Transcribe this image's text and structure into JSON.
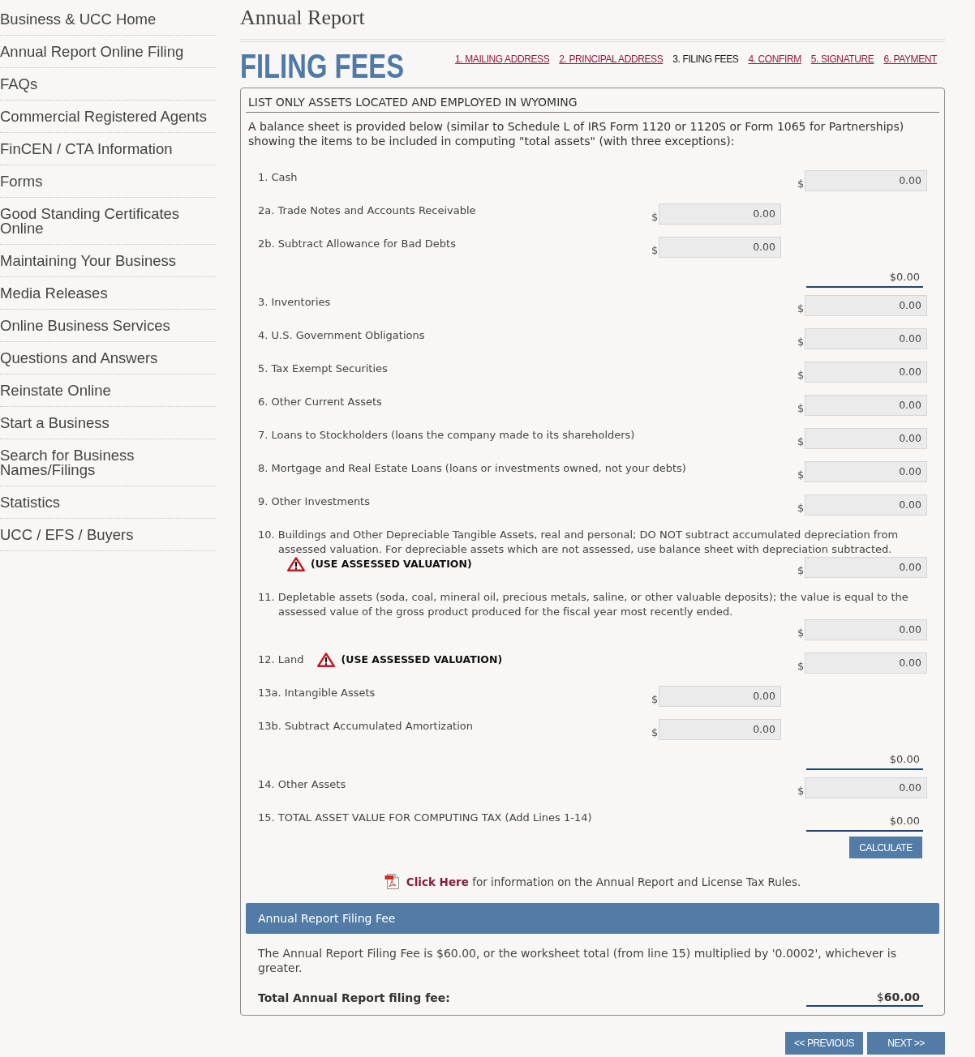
{
  "sidebar": {
    "items": [
      "Business & UCC Home",
      "Annual Report Online Filing",
      "FAQs",
      "Commercial Registered Agents",
      "FinCEN / CTA Information",
      "Forms",
      "Good Standing Certificates Online",
      "Maintaining Your Business",
      "Media Releases",
      "Online Business Services",
      "Questions and Answers",
      "Reinstate Online",
      "Start a Business",
      "Search for Business Names/Filings",
      "Statistics",
      "UCC / EFS / Buyers"
    ]
  },
  "page_title": "Annual Report",
  "heading": "FILING FEES",
  "steps": [
    {
      "label": "1. MAILING ADDRESS",
      "selected": false
    },
    {
      "label": "2. PRINCIPAL ADDRESS",
      "selected": false
    },
    {
      "label": "3. FILING FEES",
      "selected": true
    },
    {
      "label": "4. CONFIRM",
      "selected": false
    },
    {
      "label": "5. SIGNATURE",
      "selected": false
    },
    {
      "label": "6. PAYMENT",
      "selected": false
    }
  ],
  "worksheet": {
    "title": "LIST ONLY ASSETS LOCATED AND EMPLOYED IN WYOMING",
    "intro": "A balance sheet is provided below (similar to Schedule L of IRS Form 1120 or 1120S or Form 1065 for Partnerships) showing the items to be included in computing \"total assets\" (with three exceptions):",
    "lines": [
      {
        "kind": "field",
        "label": "1. Cash",
        "currency": "$",
        "value": "0.00"
      },
      {
        "kind": "subfield",
        "label": "2a. Trade Notes and Accounts Receivable",
        "currency": "$",
        "value": "0.00"
      },
      {
        "kind": "subfield",
        "label": "2b. Subtract Allowance for Bad Debts",
        "currency": "$",
        "value": "0.00"
      },
      {
        "kind": "subtotal",
        "value": "$0.00"
      },
      {
        "kind": "field",
        "label": "3. Inventories",
        "currency": "$",
        "value": "0.00"
      },
      {
        "kind": "field",
        "label": "4. U.S. Government Obligations",
        "currency": "$",
        "value": "0.00"
      },
      {
        "kind": "field",
        "label": "5. Tax Exempt Securities",
        "currency": "$",
        "value": "0.00"
      },
      {
        "kind": "field",
        "label": "6. Other Current Assets",
        "currency": "$",
        "value": "0.00"
      },
      {
        "kind": "field",
        "label": "7. Loans to Stockholders (loans the company made to its shareholders)",
        "currency": "$",
        "value": "0.00"
      },
      {
        "kind": "field",
        "label": "8. Mortgage and Real Estate Loans (loans or investments owned, not your debts)",
        "currency": "$",
        "value": "0.00"
      },
      {
        "kind": "field",
        "label": "9. Other Investments",
        "currency": "$",
        "value": "0.00"
      },
      {
        "kind": "field",
        "label": "10. Buildings and Other Depreciable Tangible Assets, real and personal; DO NOT subtract accumulated depreciation from assessed valuation.  For depreciable assets which are not assessed, use balance sheet with depreciation subtracted.",
        "warning": {
          "text": "(USE ASSESSED VALUATION)",
          "inline": false
        },
        "currency": "$",
        "value": "0.00"
      },
      {
        "kind": "field",
        "label": "11. Depletable assets (soda, coal, mineral oil, precious metals, saline, or other valuable deposits); the value is equal to the assessed value of the gross product produced for the fiscal year most recently ended.",
        "currency": "$",
        "value": "0.00"
      },
      {
        "kind": "field",
        "label": "12. Land",
        "warning": {
          "text": "(USE ASSESSED VALUATION)",
          "inline": true
        },
        "currency": "$",
        "value": "0.00"
      },
      {
        "kind": "subfield",
        "label": "13a. Intangible Assets",
        "currency": "$",
        "value": "0.00"
      },
      {
        "kind": "subfield",
        "label": "13b. Subtract Accumulated Amortization",
        "currency": "$",
        "value": "0.00"
      },
      {
        "kind": "subtotal",
        "value": "$0.00"
      },
      {
        "kind": "field",
        "label": "14. Other Assets",
        "currency": "$",
        "value": "0.00"
      },
      {
        "kind": "total",
        "label": "15. TOTAL ASSET VALUE FOR COMPUTING TAX (Add Lines 1-14)",
        "value": "$0.00"
      }
    ],
    "calculate_button": "CALCULATE",
    "info": {
      "link": "Click Here",
      "text": " for information on the Annual Report and License Tax Rules."
    }
  },
  "fee": {
    "title": "Annual Report Filing Fee",
    "description": "The Annual Report Filing Fee is $60.00, or the worksheet total (from line 15) multiplied by '0.0002', whichever is greater.",
    "total_label": "Total Annual Report filing fee:",
    "total_value": "$**60.00**"
  },
  "nav_buttons": [
    "<< PREVIOUS",
    "NEXT >>"
  ]
}
